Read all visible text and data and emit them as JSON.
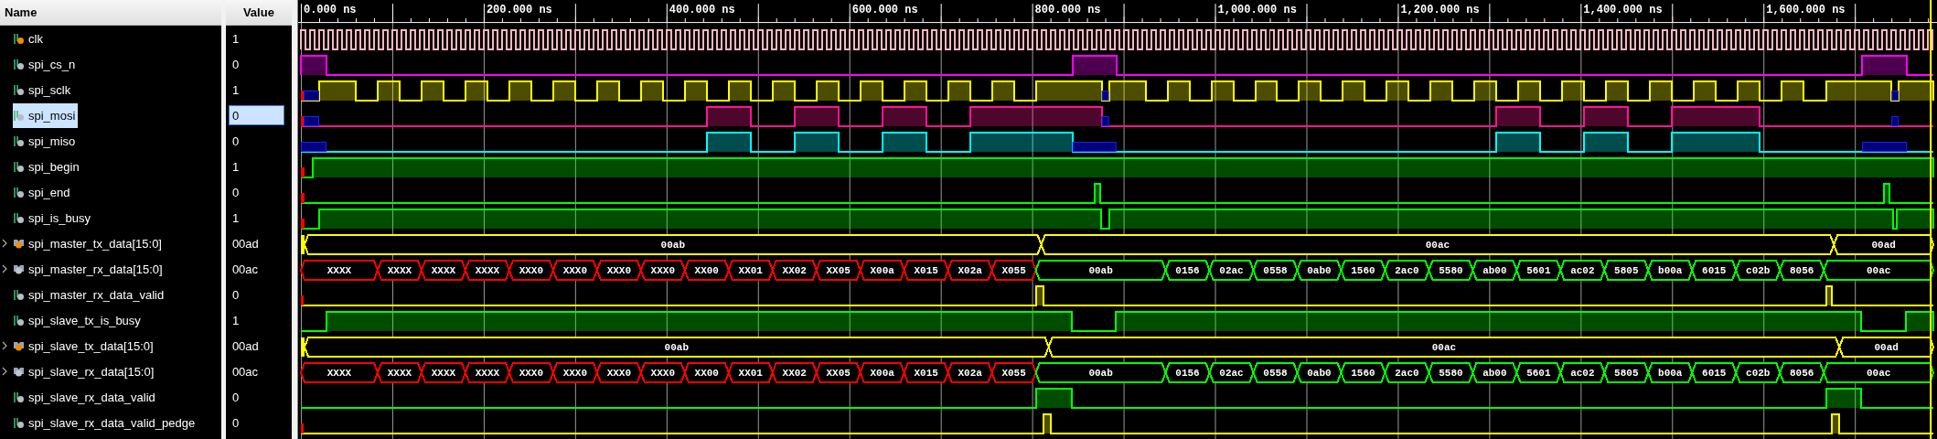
{
  "columns": {
    "name": "Name",
    "value": "Value"
  },
  "ruler": {
    "ticks": [
      "0.000 ns",
      "200.000 ns",
      "400.000 ns",
      "600.000 ns",
      "800.000 ns",
      "1,000.000 ns",
      "1,200.000 ns",
      "1,400.000 ns",
      "1,600.000 ns"
    ]
  },
  "signals": [
    {
      "name": "clk",
      "value": "1",
      "kind": "bit",
      "badge": true,
      "selected": false,
      "color": "#ffb6c1"
    },
    {
      "name": "spi_cs_n",
      "value": "0",
      "kind": "bit",
      "badge": false,
      "selected": false,
      "color": "#ff00ff"
    },
    {
      "name": "spi_sclk",
      "value": "1",
      "kind": "bit",
      "badge": false,
      "selected": false,
      "color": "#ffff00"
    },
    {
      "name": "spi_mosi",
      "value": "0",
      "kind": "bit",
      "badge": false,
      "selected": true,
      "color": "#ff1493"
    },
    {
      "name": "spi_miso",
      "value": "0",
      "kind": "bit",
      "badge": false,
      "selected": false,
      "color": "#00ffff"
    },
    {
      "name": "spi_begin",
      "value": "1",
      "kind": "bit",
      "badge": false,
      "selected": false,
      "color": "#00ff00"
    },
    {
      "name": "spi_end",
      "value": "0",
      "kind": "bit",
      "badge": false,
      "selected": false,
      "color": "#00ff00"
    },
    {
      "name": "spi_is_busy",
      "value": "1",
      "kind": "bit",
      "badge": false,
      "selected": false,
      "color": "#00ff00"
    },
    {
      "name": "spi_master_tx_data[15:0]",
      "value": "00ad",
      "kind": "bus",
      "badge": true,
      "selected": false,
      "expanded": false,
      "segments": [
        {
          "label": "00ab",
          "color": "#ffff00"
        },
        {
          "label": "00ac",
          "color": "#ffff00"
        },
        {
          "label": "00ad",
          "color": "#ffff00"
        }
      ]
    },
    {
      "name": "spi_master_rx_data[15:0]",
      "value": "00ac",
      "kind": "bus",
      "badge": false,
      "selected": false,
      "expanded": false,
      "segments": [
        {
          "label": "XXXX",
          "color": "#ff0000"
        },
        {
          "label": "XXXX",
          "color": "#ff0000"
        },
        {
          "label": "XXXX",
          "color": "#ff0000"
        },
        {
          "label": "XXXX",
          "color": "#ff0000"
        },
        {
          "label": "XXX0",
          "color": "#ff0000"
        },
        {
          "label": "XXX0",
          "color": "#ff0000"
        },
        {
          "label": "XXX0",
          "color": "#ff0000"
        },
        {
          "label": "XXX0",
          "color": "#ff0000"
        },
        {
          "label": "XX00",
          "color": "#ff0000"
        },
        {
          "label": "XX01",
          "color": "#ff0000"
        },
        {
          "label": "XX02",
          "color": "#ff0000"
        },
        {
          "label": "XX05",
          "color": "#ff0000"
        },
        {
          "label": "X00a",
          "color": "#ff0000"
        },
        {
          "label": "X015",
          "color": "#ff0000"
        },
        {
          "label": "X02a",
          "color": "#ff0000"
        },
        {
          "label": "X055",
          "color": "#ff0000"
        },
        {
          "label": "00ab",
          "color": "#00ff00"
        },
        {
          "label": "0156",
          "color": "#00ff00"
        },
        {
          "label": "02ac",
          "color": "#00ff00"
        },
        {
          "label": "0558",
          "color": "#00ff00"
        },
        {
          "label": "0ab0",
          "color": "#00ff00"
        },
        {
          "label": "1560",
          "color": "#00ff00"
        },
        {
          "label": "2ac0",
          "color": "#00ff00"
        },
        {
          "label": "5580",
          "color": "#00ff00"
        },
        {
          "label": "ab00",
          "color": "#00ff00"
        },
        {
          "label": "5601",
          "color": "#00ff00"
        },
        {
          "label": "ac02",
          "color": "#00ff00"
        },
        {
          "label": "5805",
          "color": "#00ff00"
        },
        {
          "label": "b00a",
          "color": "#00ff00"
        },
        {
          "label": "6015",
          "color": "#00ff00"
        },
        {
          "label": "c02b",
          "color": "#00ff00"
        },
        {
          "label": "8056",
          "color": "#00ff00"
        },
        {
          "label": "00ac",
          "color": "#00ff00"
        }
      ]
    },
    {
      "name": "spi_master_rx_data_valid",
      "value": "0",
      "kind": "bit",
      "badge": false,
      "selected": false,
      "color": "#ffff00"
    },
    {
      "name": "spi_slave_tx_is_busy",
      "value": "1",
      "kind": "bit",
      "badge": false,
      "selected": false,
      "color": "#00ff00"
    },
    {
      "name": "spi_slave_tx_data[15:0]",
      "value": "00ad",
      "kind": "bus",
      "badge": true,
      "selected": false,
      "expanded": false,
      "segments": [
        {
          "label": "00ab",
          "color": "#ffff00"
        },
        {
          "label": "00ac",
          "color": "#ffff00"
        },
        {
          "label": "00ad",
          "color": "#ffff00"
        }
      ]
    },
    {
      "name": "spi_slave_rx_data[15:0]",
      "value": "00ac",
      "kind": "bus",
      "badge": false,
      "selected": false,
      "expanded": false,
      "segments": [
        {
          "label": "XXXX",
          "color": "#ff0000"
        },
        {
          "label": "XXXX",
          "color": "#ff0000"
        },
        {
          "label": "XXXX",
          "color": "#ff0000"
        },
        {
          "label": "XXXX",
          "color": "#ff0000"
        },
        {
          "label": "XXX0",
          "color": "#ff0000"
        },
        {
          "label": "XXX0",
          "color": "#ff0000"
        },
        {
          "label": "XXX0",
          "color": "#ff0000"
        },
        {
          "label": "XXX0",
          "color": "#ff0000"
        },
        {
          "label": "XX00",
          "color": "#ff0000"
        },
        {
          "label": "XX01",
          "color": "#ff0000"
        },
        {
          "label": "XX02",
          "color": "#ff0000"
        },
        {
          "label": "XX05",
          "color": "#ff0000"
        },
        {
          "label": "X00a",
          "color": "#ff0000"
        },
        {
          "label": "X015",
          "color": "#ff0000"
        },
        {
          "label": "X02a",
          "color": "#ff0000"
        },
        {
          "label": "X055",
          "color": "#ff0000"
        },
        {
          "label": "00ab",
          "color": "#00ff00"
        },
        {
          "label": "0156",
          "color": "#00ff00"
        },
        {
          "label": "02ac",
          "color": "#00ff00"
        },
        {
          "label": "0558",
          "color": "#00ff00"
        },
        {
          "label": "0ab0",
          "color": "#00ff00"
        },
        {
          "label": "1560",
          "color": "#00ff00"
        },
        {
          "label": "2ac0",
          "color": "#00ff00"
        },
        {
          "label": "5580",
          "color": "#00ff00"
        },
        {
          "label": "ab00",
          "color": "#00ff00"
        },
        {
          "label": "5601",
          "color": "#00ff00"
        },
        {
          "label": "ac02",
          "color": "#00ff00"
        },
        {
          "label": "5805",
          "color": "#00ff00"
        },
        {
          "label": "b00a",
          "color": "#00ff00"
        },
        {
          "label": "6015",
          "color": "#00ff00"
        },
        {
          "label": "c02b",
          "color": "#00ff00"
        },
        {
          "label": "8056",
          "color": "#00ff00"
        },
        {
          "label": "00ac",
          "color": "#00ff00"
        }
      ]
    },
    {
      "name": "spi_slave_rx_data_valid",
      "value": "0",
      "kind": "bit",
      "badge": false,
      "selected": false,
      "color": "#00ff00"
    },
    {
      "name": "spi_slave_rx_data_valid_pedge",
      "value": "0",
      "kind": "bit",
      "badge": false,
      "selected": false,
      "color": "#ffff00"
    }
  ]
}
